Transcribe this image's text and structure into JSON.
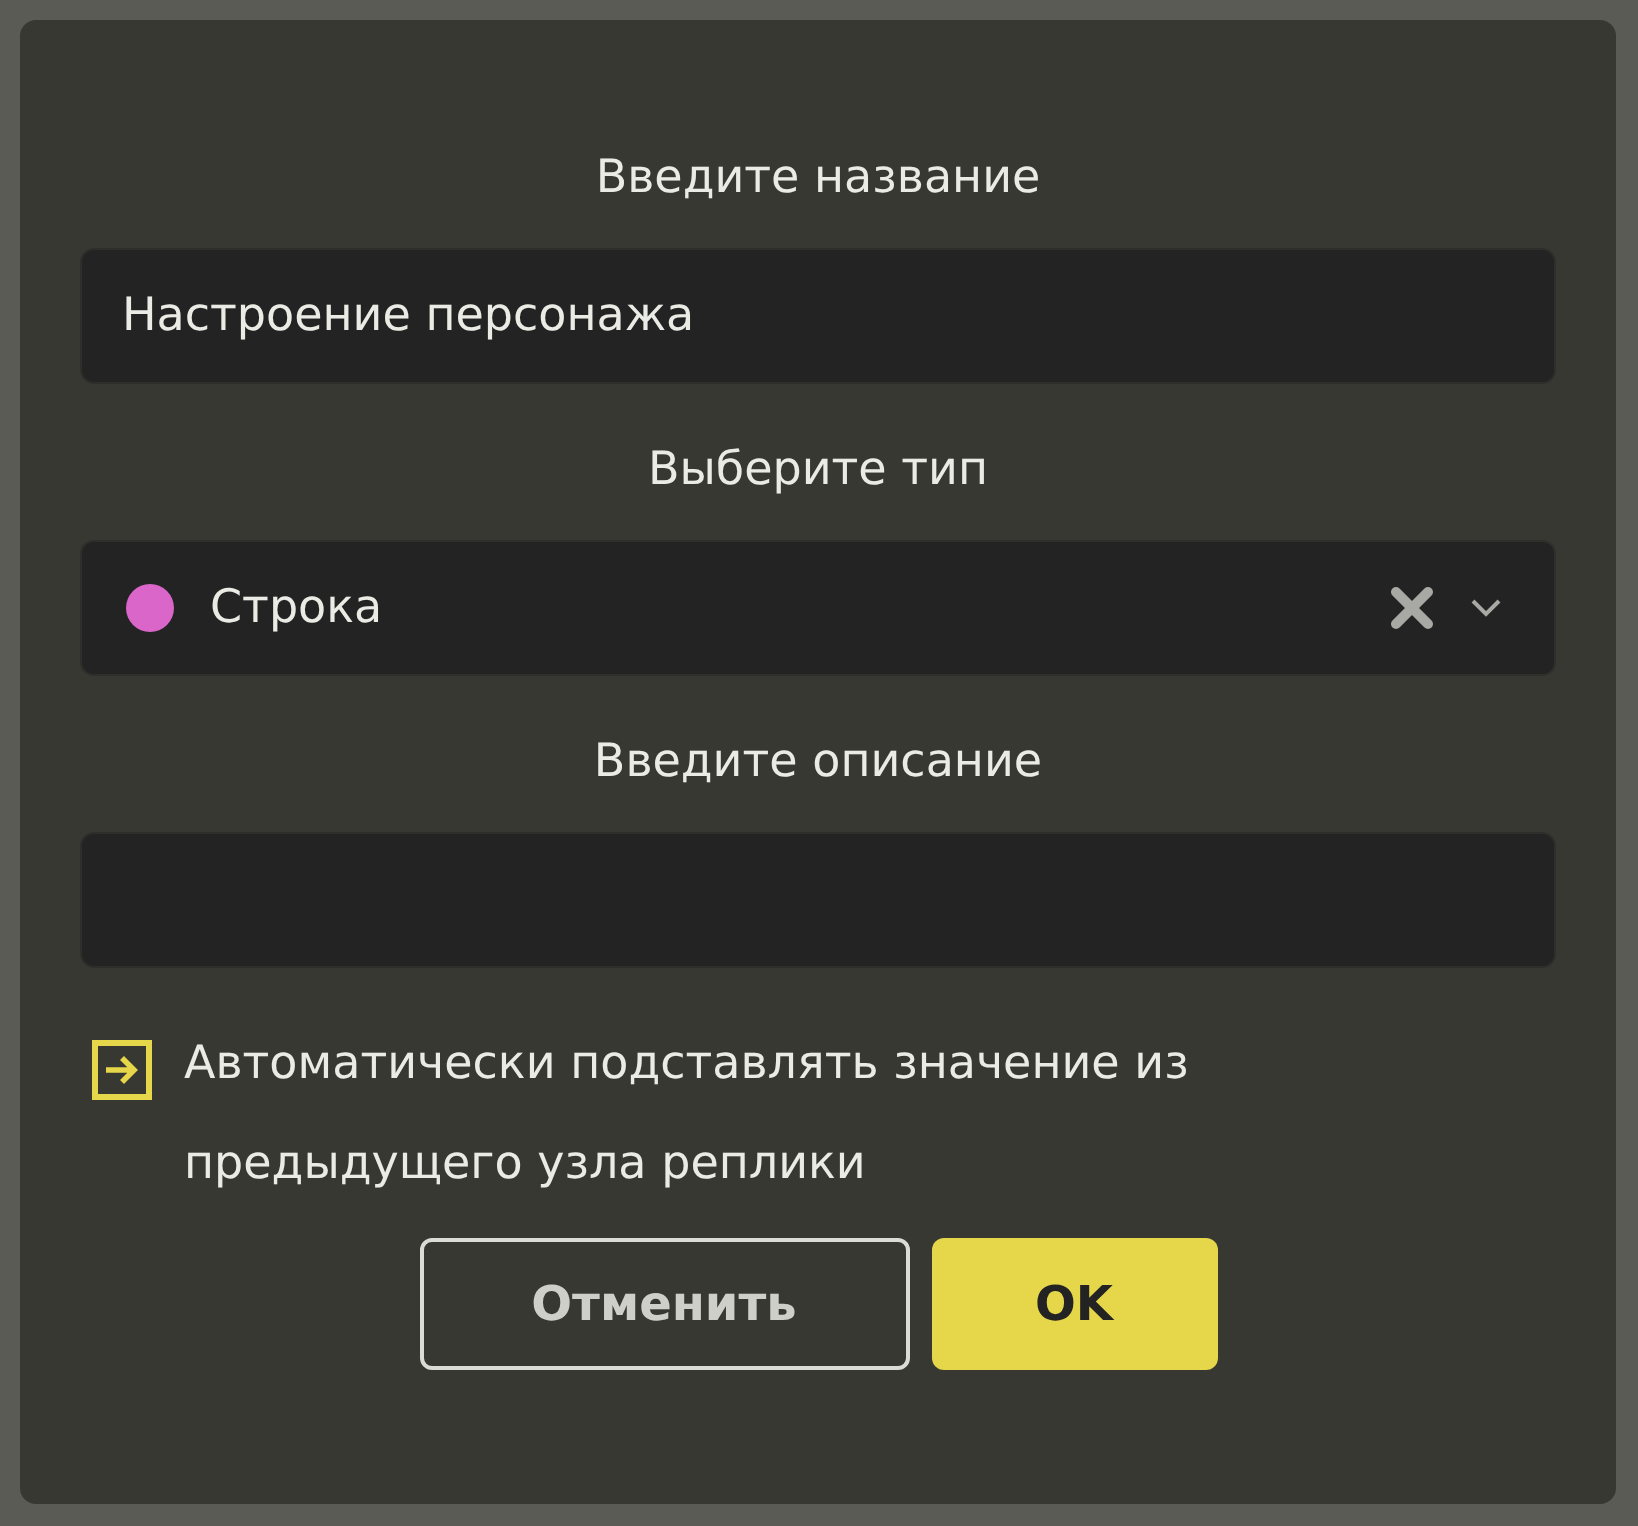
{
  "dialog": {
    "name_label": "Введите название",
    "name_field": {
      "value": "Настроение персонажа"
    },
    "type_label": "Выберите тип",
    "type_select": {
      "value": "Строка",
      "color": "#d966c8"
    },
    "description_label": "Введите описание",
    "auto_fill": {
      "label": "Автоматически подставлять значение из предыдущего узла реплики",
      "checked": true
    },
    "buttons": [
      {
        "label": "Отменить",
        "kind": "secondary"
      },
      {
        "label": "OK",
        "kind": "primary"
      }
    ]
  }
}
